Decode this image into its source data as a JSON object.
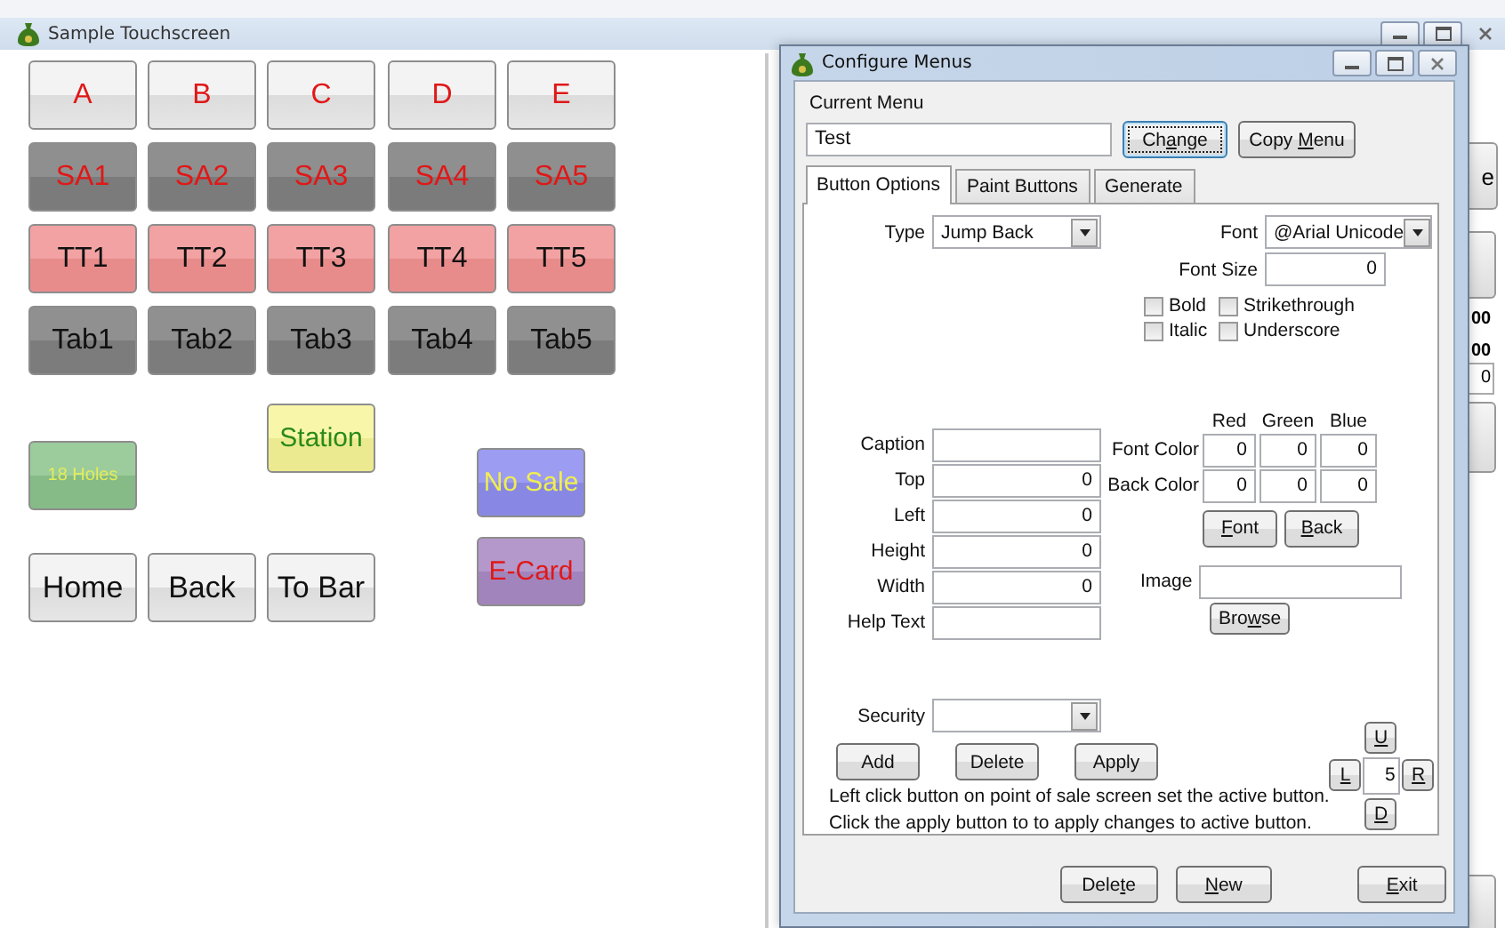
{
  "main_window": {
    "title": "Sample Touchscreen"
  },
  "touch_buttons": [
    {
      "label": "A",
      "kind": "letter"
    },
    {
      "label": "B",
      "kind": "letter"
    },
    {
      "label": "C",
      "kind": "letter"
    },
    {
      "label": "D",
      "kind": "letter"
    },
    {
      "label": "E",
      "kind": "letter"
    },
    {
      "label": "SA1",
      "kind": "sa"
    },
    {
      "label": "SA2",
      "kind": "sa"
    },
    {
      "label": "SA3",
      "kind": "sa"
    },
    {
      "label": "SA4",
      "kind": "sa"
    },
    {
      "label": "SA5",
      "kind": "sa"
    },
    {
      "label": "TT1",
      "kind": "tt"
    },
    {
      "label": "TT2",
      "kind": "tt"
    },
    {
      "label": "TT3",
      "kind": "tt"
    },
    {
      "label": "TT4",
      "kind": "tt"
    },
    {
      "label": "TT5",
      "kind": "tt"
    },
    {
      "label": "Tab1",
      "kind": "tab"
    },
    {
      "label": "Tab2",
      "kind": "tab"
    },
    {
      "label": "Tab3",
      "kind": "tab"
    },
    {
      "label": "Tab4",
      "kind": "tab"
    },
    {
      "label": "Tab5",
      "kind": "tab"
    },
    {
      "label": "Station",
      "kind": "station"
    },
    {
      "label": "18 Holes",
      "kind": "holes"
    },
    {
      "label": "No Sale",
      "kind": "nosale"
    },
    {
      "label": "E-Card",
      "kind": "ecard"
    },
    {
      "label": "Home",
      "kind": "nav"
    },
    {
      "label": "Back",
      "kind": "nav"
    },
    {
      "label": "To Bar",
      "kind": "nav"
    }
  ],
  "background_fragments": [
    "e",
    "00",
    "00",
    "0"
  ],
  "dialog": {
    "title": "Configure Menus",
    "current_menu_label": "Current Menu",
    "current_menu_value": "Test",
    "top_buttons": [
      {
        "before": "Ch",
        "key": "a",
        "after": "nge",
        "focused": true
      },
      {
        "before": "Copy ",
        "key": "M",
        "after": "enu",
        "focused": false
      }
    ],
    "tabs": [
      {
        "label": "Button Options",
        "selected": true
      },
      {
        "label": "Paint Buttons",
        "selected": false
      },
      {
        "label": "Generate",
        "selected": false
      }
    ],
    "type": {
      "label": "Type",
      "value": "Jump Back"
    },
    "font": {
      "label": "Font",
      "value": "@Arial Unicode"
    },
    "font_size": {
      "label": "Font Size",
      "value": "0"
    },
    "styles": [
      {
        "label": "Bold",
        "checked": false
      },
      {
        "label": "Strikethrough",
        "checked": false
      },
      {
        "label": "Italic",
        "checked": false
      },
      {
        "label": "Underscore",
        "checked": false
      }
    ],
    "fields": [
      {
        "label": "Caption"
      },
      {
        "label": "Top",
        "value": "0"
      },
      {
        "label": "Left",
        "value": "0"
      },
      {
        "label": "Height",
        "value": "0"
      },
      {
        "label": "Width",
        "value": "0"
      },
      {
        "label": "Help Text"
      }
    ],
    "color_headers": [
      "Red",
      "Green",
      "Blue"
    ],
    "color_rows": [
      {
        "label": "Font Color",
        "values": [
          "0",
          "0",
          "0"
        ]
      },
      {
        "label": "Back Color",
        "values": [
          "0",
          "0",
          "0"
        ]
      }
    ],
    "color_buttons": [
      {
        "key": "F",
        "after": "ont"
      },
      {
        "key": "B",
        "after": "ack"
      }
    ],
    "image": {
      "label": "Image"
    },
    "browse_button": {
      "before": "Bro",
      "key": "w",
      "after": "se"
    },
    "security": {
      "label": "Security"
    },
    "action_buttons": [
      "Add",
      "Delete",
      "Apply"
    ],
    "notes": [
      "Left click button on point of sale screen set the active button.",
      "Click the apply button to to apply changes to active button."
    ],
    "nudge_buttons": [
      {
        "kind": "up",
        "key": "U"
      },
      {
        "kind": "left",
        "key": "L"
      },
      {
        "kind": "right",
        "key": "R"
      },
      {
        "kind": "down",
        "key": "D"
      }
    ],
    "nudge_step": "5",
    "bottom_buttons": [
      {
        "before": "Dele",
        "key": "t",
        "after": "e"
      },
      {
        "key": "N",
        "after": "ew"
      },
      {
        "key": "E",
        "after": "xit"
      }
    ]
  }
}
